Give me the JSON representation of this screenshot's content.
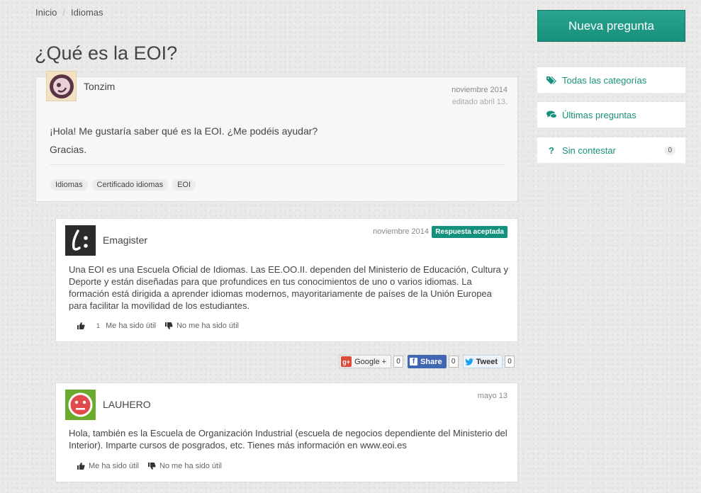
{
  "breadcrumb": {
    "home": "Inicio",
    "separator": "/",
    "current": "Idiomas"
  },
  "page_title": "¿Qué es la EOI?",
  "question": {
    "user": "Tonzim",
    "date": "noviembre 2014",
    "edited": "editado abril 13.",
    "body_line1": "¡Hola! Me gustaría saber qué es la EOI. ¿Me podéis ayudar?",
    "body_line2": "Gracias.",
    "tags": [
      "Idiomas",
      "Certificado idiomas",
      "EOI"
    ]
  },
  "answers": [
    {
      "user": "Emagister",
      "date": "noviembre 2014",
      "badge": "Respuesta aceptada",
      "body": "Una EOI es una Escuela Oficial de Idiomas. Las EE.OO.II. dependen del Ministerio de Educación, Cultura y Deporte y están diseñadas para que profundices en tus conocimientos de uno o varios idiomas. La formación está dirigida a aprender idiomas modernos, mayoritariamente de países de la Unión Europea para facilitar la movilidad de los estudiantes.",
      "useful_count": "1",
      "useful_label": "Me ha sido útil",
      "not_useful_label": "No me ha sido útil"
    },
    {
      "user": "LAUHERO",
      "date": "mayo 13",
      "body": "Hola, también es la Escuela de Organización Industrial (escuela de negocios dependiente del Ministerio del Interior). Imparte cursos de posgrados, etc. Tienes más información en www.eoi.es",
      "useful_label": "Me ha sido útil",
      "not_useful_label": "No me ha sido útil"
    }
  ],
  "share": {
    "google_label": "Google +",
    "google_icon": "g+",
    "google_count": "0",
    "facebook_label": "Share",
    "facebook_icon": "f",
    "facebook_count": "0",
    "twitter_label": "Tweet",
    "twitter_count": "0"
  },
  "sidebar": {
    "new_question": "Nueva pregunta",
    "all_categories": "Todas las categorías",
    "latest_questions": "Últimas preguntas",
    "unanswered": "Sin contestar",
    "unanswered_count": "0"
  },
  "colors": {
    "accent": "#17917c",
    "badge": "#13917d",
    "facebook": "#4267b2",
    "google": "#dd4b39"
  },
  "icons": [
    "tags-icon",
    "comments-icon",
    "question-icon",
    "thumbs-up-icon",
    "thumbs-down-icon"
  ]
}
